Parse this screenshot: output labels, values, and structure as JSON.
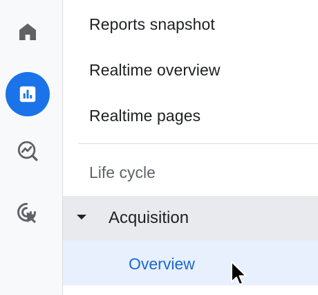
{
  "rail": {
    "items": [
      {
        "icon": "home-icon",
        "active": false
      },
      {
        "icon": "reports-icon",
        "active": true
      },
      {
        "icon": "explore-icon",
        "active": false
      },
      {
        "icon": "advertising-icon",
        "active": false
      }
    ],
    "accent_color": "#1a73e8"
  },
  "nav": {
    "links": [
      {
        "label": "Reports snapshot"
      },
      {
        "label": "Realtime overview"
      },
      {
        "label": "Realtime pages"
      }
    ],
    "section_label": "Life cycle",
    "group": {
      "label": "Acquisition",
      "expanded": true,
      "caret_icon": "caret-down-icon"
    },
    "subitem": {
      "label": "Overview",
      "selected": true,
      "color": "#1967d2"
    }
  },
  "cursor_icon": "mouse-pointer-icon"
}
